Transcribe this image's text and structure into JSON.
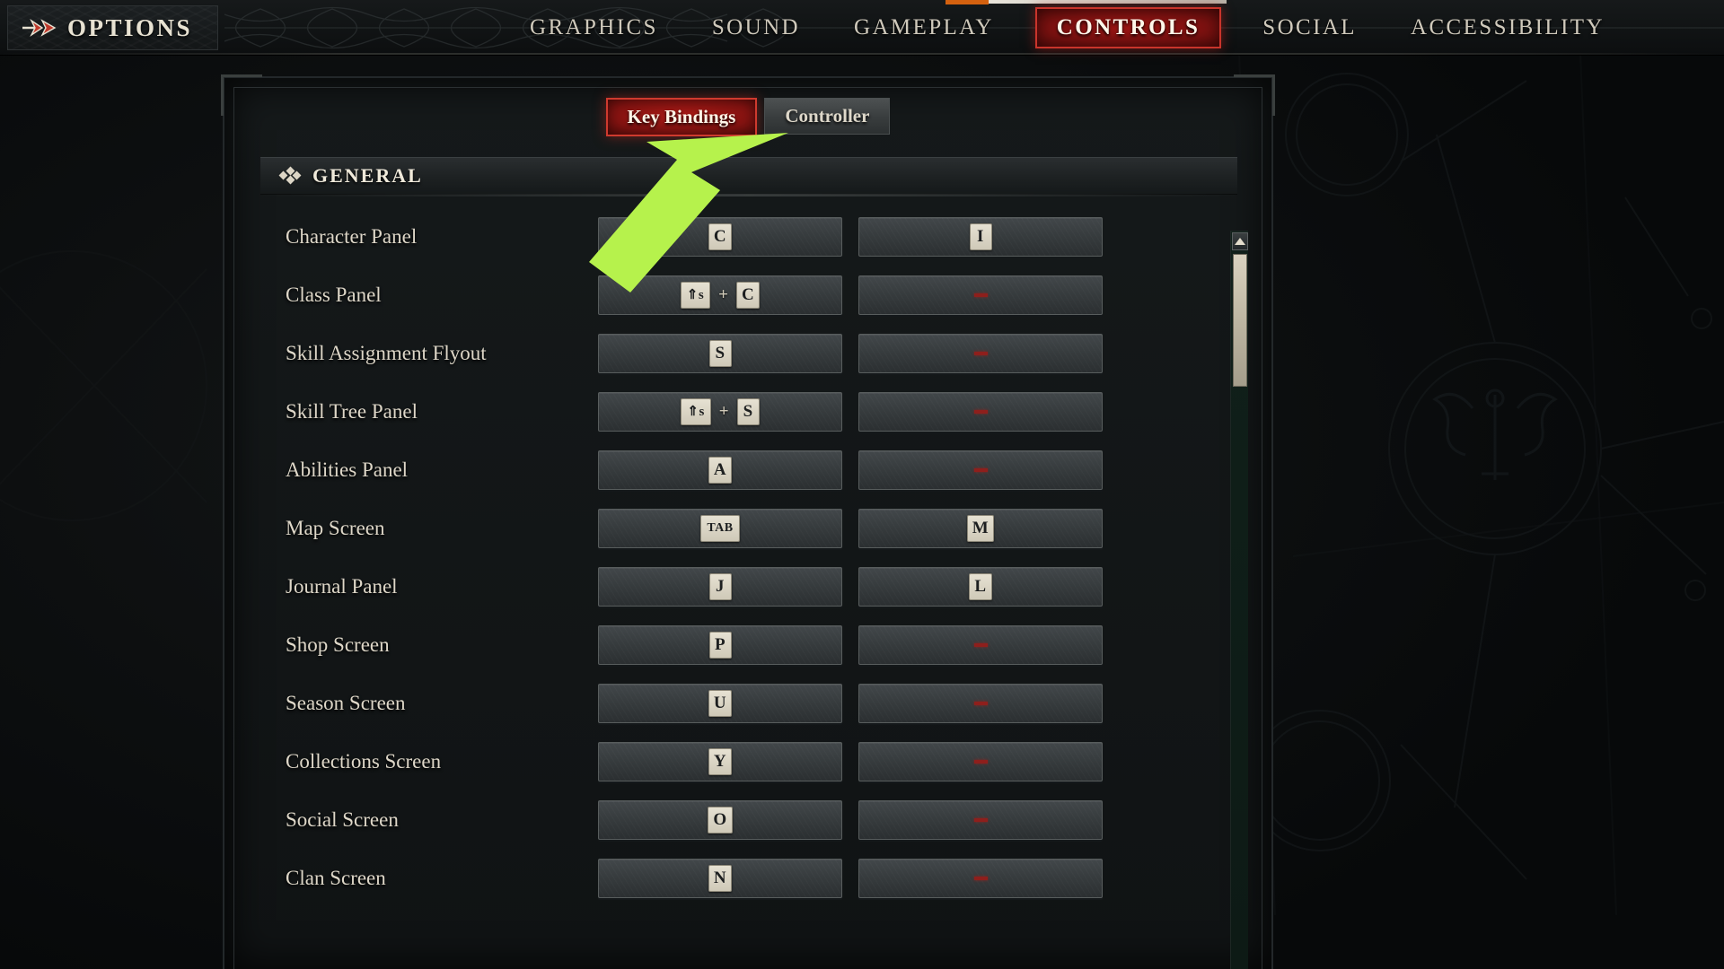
{
  "header": {
    "title": "OPTIONS",
    "arrow_icon": "double-arrow-icon",
    "tabs": [
      {
        "label": "GRAPHICS",
        "active": false
      },
      {
        "label": "SOUND",
        "active": false
      },
      {
        "label": "GAMEPLAY",
        "active": false
      },
      {
        "label": "CONTROLS",
        "active": true
      },
      {
        "label": "SOCIAL",
        "active": false
      },
      {
        "label": "ACCESSIBILITY",
        "active": false
      }
    ],
    "accent_active": "#9b1513",
    "accent_border": "#c9342b",
    "text_color": "#cfc9bb",
    "orange_marker": "#d4610f"
  },
  "subtabs": [
    {
      "label": "Key Bindings",
      "active": true
    },
    {
      "label": "Controller",
      "active": false
    }
  ],
  "section": {
    "title": "GENERAL",
    "icon": "diamond-cluster-icon"
  },
  "unbound_symbol": "--",
  "bindings": [
    {
      "action": "Character Panel",
      "primary": [
        "C"
      ],
      "secondary": [
        "I"
      ]
    },
    {
      "action": "Class Panel",
      "primary": [
        "⇑s",
        "+",
        "C"
      ],
      "secondary": []
    },
    {
      "action": "Skill Assignment Flyout",
      "primary": [
        "S"
      ],
      "secondary": []
    },
    {
      "action": "Skill Tree Panel",
      "primary": [
        "⇑s",
        "+",
        "S"
      ],
      "secondary": []
    },
    {
      "action": "Abilities Panel",
      "primary": [
        "A"
      ],
      "secondary": []
    },
    {
      "action": "Map Screen",
      "primary": [
        "TAB"
      ],
      "secondary": [
        "M"
      ]
    },
    {
      "action": "Journal Panel",
      "primary": [
        "J"
      ],
      "secondary": [
        "L"
      ]
    },
    {
      "action": "Shop Screen",
      "primary": [
        "P"
      ],
      "secondary": []
    },
    {
      "action": "Season Screen",
      "primary": [
        "U"
      ],
      "secondary": []
    },
    {
      "action": "Collections Screen",
      "primary": [
        "Y"
      ],
      "secondary": []
    },
    {
      "action": "Social Screen",
      "primary": [
        "O"
      ],
      "secondary": []
    },
    {
      "action": "Clan Screen",
      "primary": [
        "N"
      ],
      "secondary": []
    }
  ],
  "scrollbar": {
    "up_arrow_icon": "triangle-up-icon",
    "thumb_color": "#d9d2bf"
  },
  "annotation": {
    "type": "arrow-pointer",
    "color": "#b6f24c",
    "points_to": "Controller"
  }
}
